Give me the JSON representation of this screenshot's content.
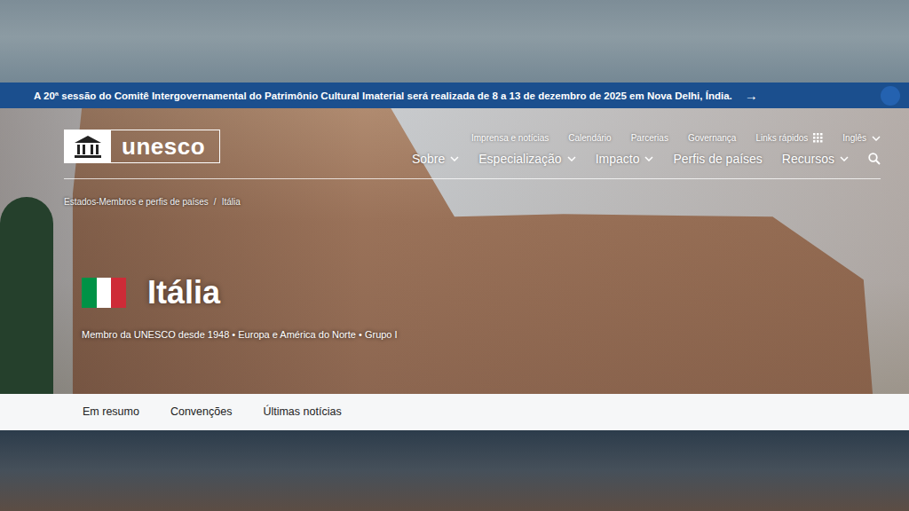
{
  "banner": {
    "text": "A 20ª sessão do Comitê Intergovernamental do Patrimônio Cultural Imaterial será realizada de 8 a 13 de dezembro de 2025 em Nova Delhi, Índia.",
    "arrow": "→"
  },
  "logo": {
    "text": "unesco"
  },
  "top_links": [
    "Imprensa e notícias",
    "Calendário",
    "Parcerias",
    "Governança",
    "Links rápidos"
  ],
  "language": "Inglês",
  "nav": [
    {
      "label": "Sobre",
      "dropdown": true
    },
    {
      "label": "Especialização",
      "dropdown": true
    },
    {
      "label": "Impacto",
      "dropdown": true
    },
    {
      "label": "Perfis de países",
      "dropdown": false
    },
    {
      "label": "Recursos",
      "dropdown": true
    }
  ],
  "breadcrumb": [
    "Estados-Membros e perfis de países",
    "/",
    "Itália"
  ],
  "country": {
    "name": "Itália",
    "subtitle": "Membro da UNESCO desde 1948 • Europa e América do Norte • Grupo I"
  },
  "tabs": [
    {
      "label": "Em resumo",
      "selected": false
    },
    {
      "label": "Convenções",
      "selected": false
    },
    {
      "label": "Últimas notícias",
      "selected": false
    }
  ]
}
